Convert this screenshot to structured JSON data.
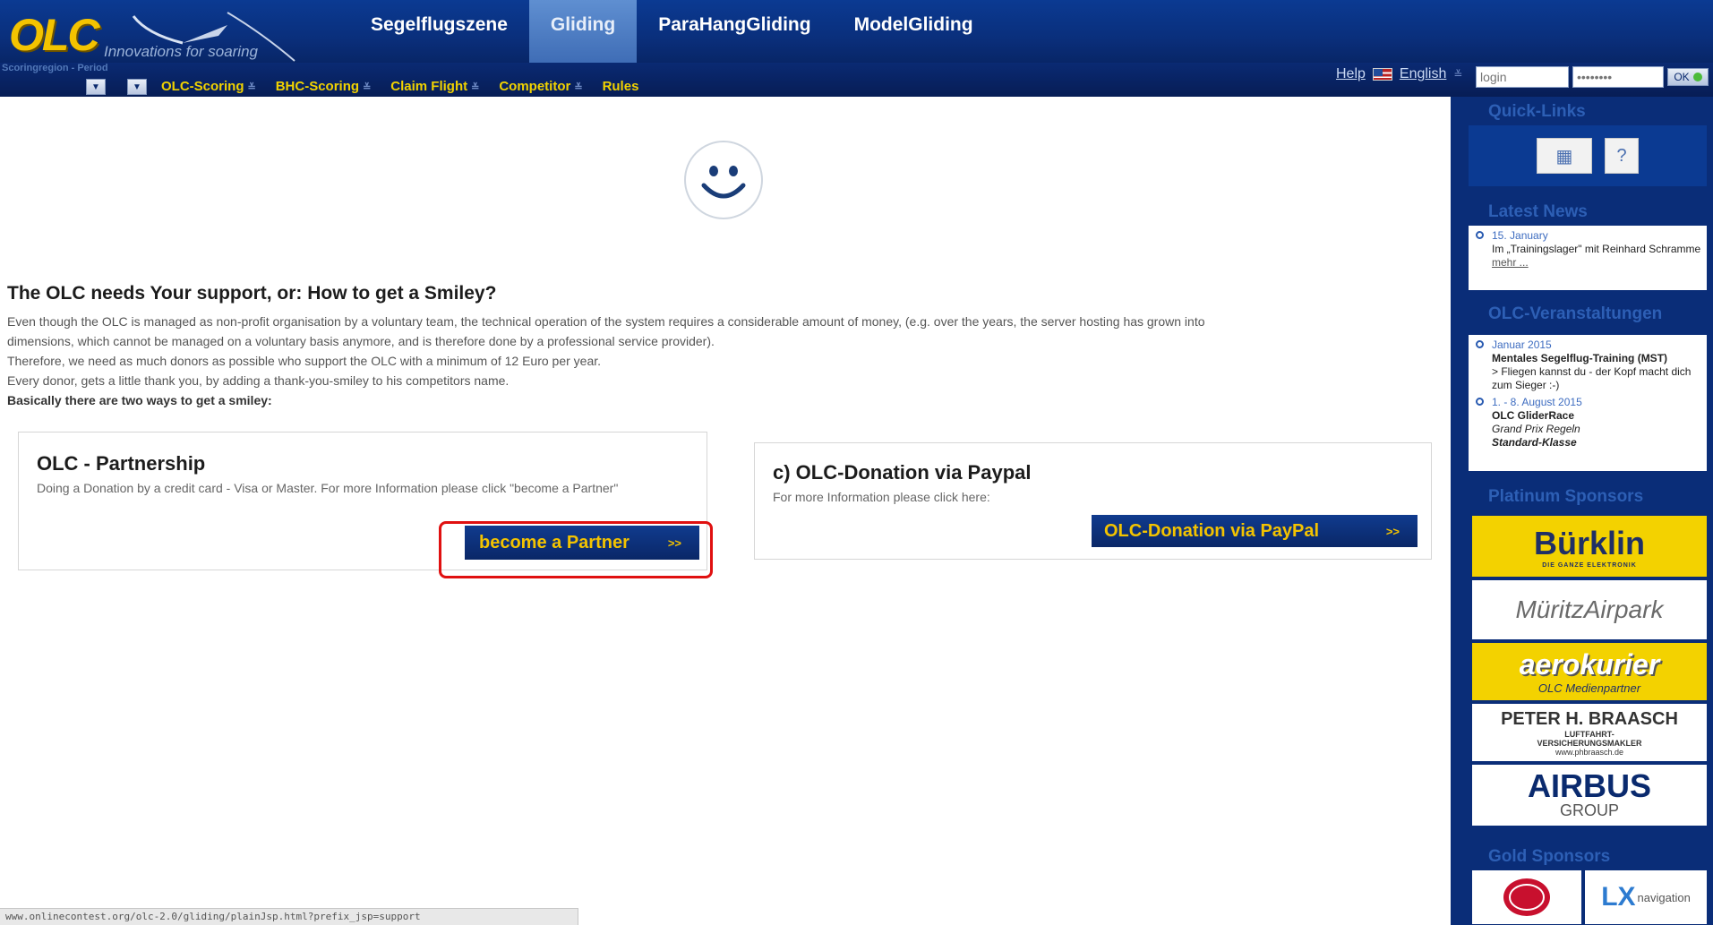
{
  "header": {
    "logo_text": "OLC",
    "logo_tagline": "Innovations for soaring",
    "main_tabs": [
      {
        "label": "Segelflugszene",
        "active": false
      },
      {
        "label": "Gliding",
        "active": true
      },
      {
        "label": "ParaHangGliding",
        "active": false
      },
      {
        "label": "ModelGliding",
        "active": false
      }
    ],
    "region_label": "Scoringregion - Period",
    "sub_nav": [
      {
        "label": "OLC-Scoring"
      },
      {
        "label": "BHC-Scoring"
      },
      {
        "label": "Claim Flight"
      },
      {
        "label": "Competitor"
      },
      {
        "label": "Rules"
      }
    ],
    "help_label": "Help",
    "language_label": "English",
    "login_placeholder": "login",
    "password_placeholder": "••••••••",
    "ok_label": "OK"
  },
  "main": {
    "headline": "The OLC needs Your support, or: How to get a Smiley?",
    "paragraph_lines": [
      "Even though the OLC is managed as non-profit organisation by a voluntary team, the technical operation of the system requires a considerable amount of money, (e.g. over the years, the server hosting has grown into",
      "dimensions, which cannot be managed on a voluntary basis anymore, and is therefore done by a professional service provider).",
      "Therefore, we need as much donors as possible who support the OLC with a minimum of 12 Euro per year.",
      "Every donor, gets a little thank you, by adding a thank-you-smiley to his competitors name."
    ],
    "paragraph_bold": "Basically there are two ways to get a smiley:",
    "partnership": {
      "title": "OLC - Partnership",
      "text": "Doing a Donation by a credit card - Visa or Master. For more Information please click \"become a Partner\"",
      "button_label": "become a Partner",
      "button_arrow": ">>"
    },
    "paypal": {
      "title": "c) OLC-Donation via Paypal",
      "text": "For more Information please click here:",
      "button_label": "OLC-Donation via PayPal",
      "button_arrow": ">>"
    }
  },
  "status_bar": {
    "url": "www.onlinecontest.org/olc-2.0/gliding/plainJsp.html?prefix_jsp=support"
  },
  "sidebar": {
    "quick_links_title": "Quick-Links",
    "latest_news_title": "Latest News",
    "news": [
      {
        "date": "15. January",
        "text": "Im „Trainingslager\" mit Reinhard Schramme",
        "more": "mehr ..."
      }
    ],
    "events_title": "OLC-Veranstaltungen",
    "events": [
      {
        "date": "Januar 2015",
        "title": "Mentales Segelflug-Training (MST)",
        "text": "> Fliegen kannst du - der Kopf macht dich zum Sieger :-)"
      },
      {
        "date": "1. - 8. August 2015",
        "title": "OLC GliderRace",
        "text": "Grand Prix Regeln",
        "extra": "Standard-Klasse"
      }
    ],
    "platinum_title": "Platinum Sponsors",
    "sponsors": {
      "burklin": "Bürklin",
      "burklin_sub": "DIE GANZE ELEKTRONIK",
      "muritz": "MüritzAirpark",
      "aero": "aerokurier",
      "aero_sub": "OLC Medienpartner",
      "braasch_name": "PETER H. BRAASCH",
      "braasch_line1": "LUFTFAHRT-",
      "braasch_line2": "VERSICHERUNGSMAKLER",
      "braasch_url": "www.phbraasch.de",
      "airbus": "AIRBUS",
      "airbus_sub": "GROUP"
    },
    "gold_title": "Gold Sponsors",
    "gold": {
      "lx_text": "navigation"
    }
  },
  "colors": {
    "nav_blue": "#0a2f7c",
    "accent_yellow": "#f3c300",
    "highlight_red": "#e01010"
  }
}
